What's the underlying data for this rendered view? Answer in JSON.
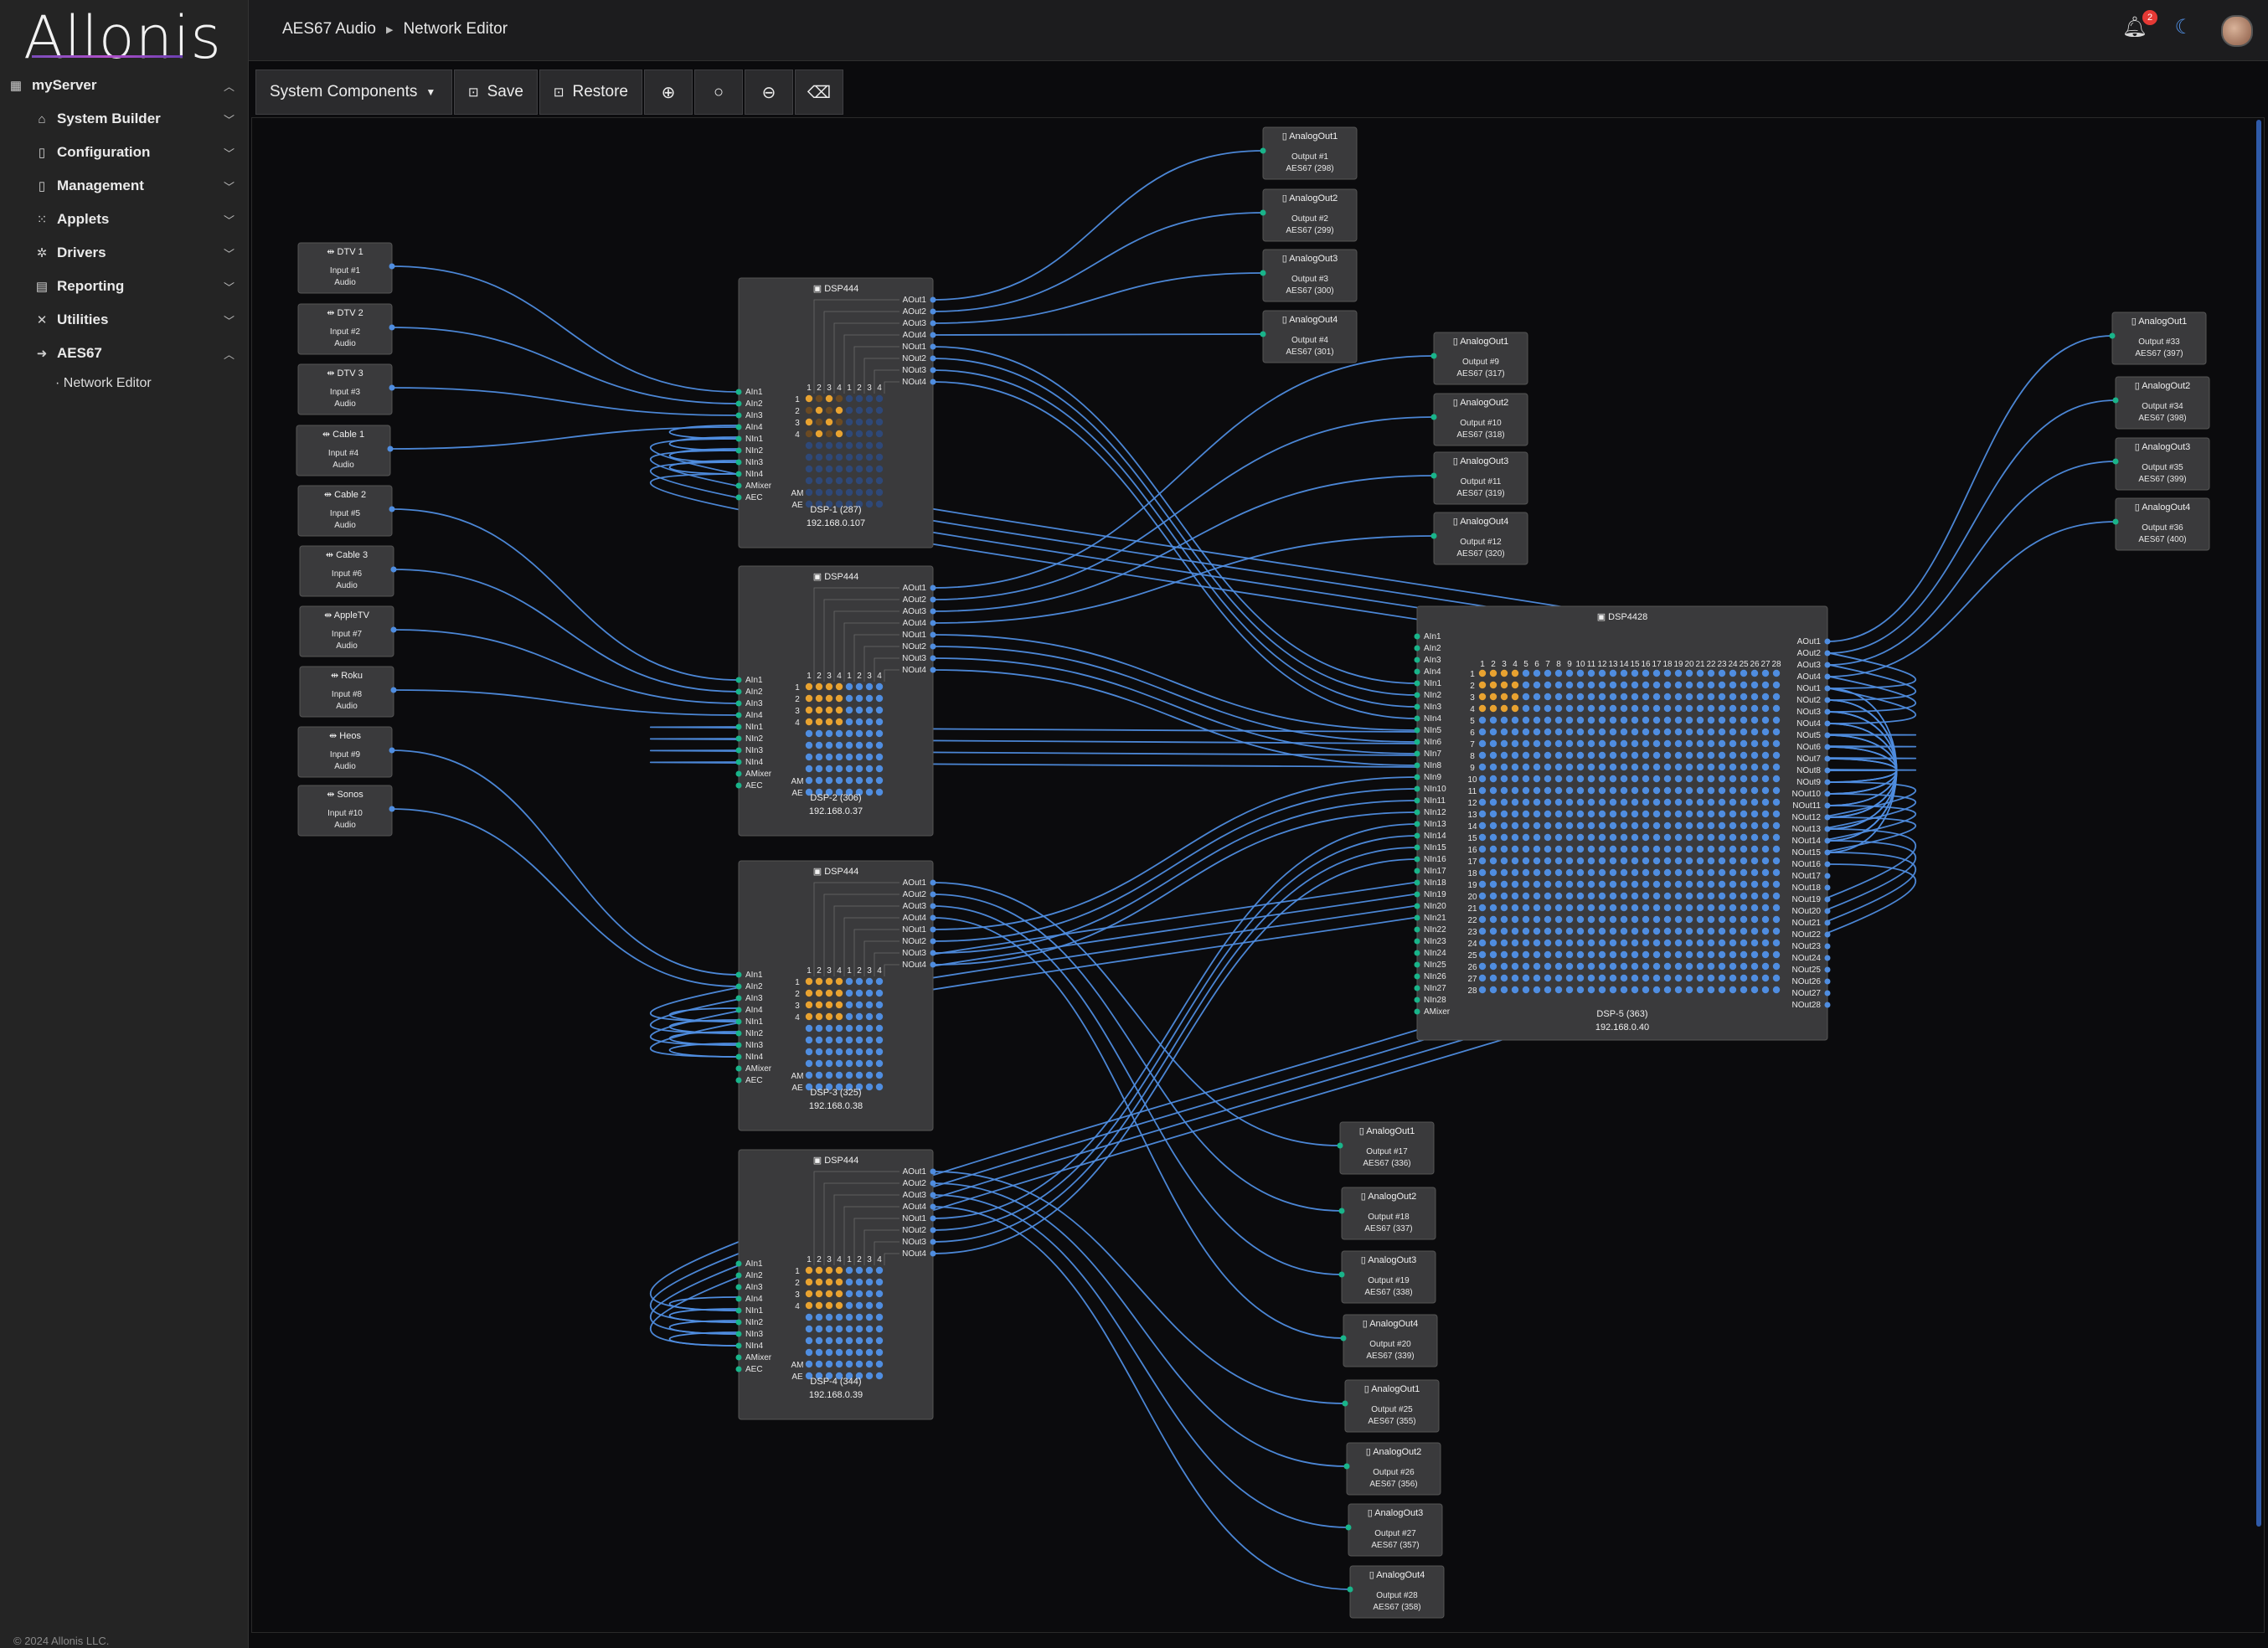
{
  "app": {
    "logo": "Allonis",
    "copyright": "© 2024 Allonis LLC."
  },
  "sidebar": {
    "server": "myServer",
    "items": [
      {
        "label": "System Builder",
        "icon": "home-icon"
      },
      {
        "label": "Configuration",
        "icon": "document-icon"
      },
      {
        "label": "Management",
        "icon": "document-icon"
      },
      {
        "label": "Applets",
        "icon": "grid-icon"
      },
      {
        "label": "Drivers",
        "icon": "drivers-icon"
      },
      {
        "label": "Reporting",
        "icon": "report-icon"
      },
      {
        "label": "Utilities",
        "icon": "tools-icon"
      },
      {
        "label": "AES67",
        "icon": "aes67-icon"
      }
    ],
    "subitem": "· Network Editor"
  },
  "header": {
    "breadcrumb_root": "AES67 Audio",
    "breadcrumb_page": "Network Editor",
    "notifications": "2"
  },
  "toolbar": {
    "components_label": "System Components",
    "save_label": "Save",
    "restore_label": "Restore"
  },
  "colors": {
    "accent": "#4f8de0",
    "routed": "#e8a230",
    "node_bg": "#3a3a3c",
    "link": "#4f8de0"
  },
  "inputs": [
    {
      "name": "DTV 1",
      "line1": "Input #1",
      "line2": "Audio"
    },
    {
      "name": "DTV 2",
      "line1": "Input #2",
      "line2": "Audio"
    },
    {
      "name": "DTV 3",
      "line1": "Input #3",
      "line2": "Audio"
    },
    {
      "name": "Cable 1",
      "line1": "Input #4",
      "line2": "Audio"
    },
    {
      "name": "Cable 2",
      "line1": "Input #5",
      "line2": "Audio"
    },
    {
      "name": "Cable 3",
      "line1": "Input #6",
      "line2": "Audio"
    },
    {
      "name": "AppleTV",
      "line1": "Input #7",
      "line2": "Audio"
    },
    {
      "name": "Roku",
      "line1": "Input #8",
      "line2": "Audio"
    },
    {
      "name": "Heos",
      "line1": "Input #9",
      "line2": "Audio"
    },
    {
      "name": "Sonos",
      "line1": "Input #10",
      "line2": "Audio"
    }
  ],
  "dsps": [
    {
      "type": "DSP444",
      "label": "DSP-1 (287)",
      "ip": "192.168.0.107"
    },
    {
      "type": "DSP444",
      "label": "DSP-2 (306)",
      "ip": "192.168.0.37"
    },
    {
      "type": "DSP444",
      "label": "DSP-3 (325)",
      "ip": "192.168.0.38"
    },
    {
      "type": "DSP444",
      "label": "DSP-4 (344)",
      "ip": "192.168.0.39"
    },
    {
      "type": "DSP4428",
      "label": "DSP-5 (363)",
      "ip": "192.168.0.40"
    }
  ],
  "outputs": [
    {
      "name": "AnalogOut1",
      "line1": "Output #1",
      "line2": "AES67 (298)"
    },
    {
      "name": "AnalogOut2",
      "line1": "Output #2",
      "line2": "AES67 (299)"
    },
    {
      "name": "AnalogOut3",
      "line1": "Output #3",
      "line2": "AES67 (300)"
    },
    {
      "name": "AnalogOut4",
      "line1": "Output #4",
      "line2": "AES67 (301)"
    },
    {
      "name": "AnalogOut1",
      "line1": "Output #9",
      "line2": "AES67 (317)"
    },
    {
      "name": "AnalogOut2",
      "line1": "Output #10",
      "line2": "AES67 (318)"
    },
    {
      "name": "AnalogOut3",
      "line1": "Output #11",
      "line2": "AES67 (319)"
    },
    {
      "name": "AnalogOut4",
      "line1": "Output #12",
      "line2": "AES67 (320)"
    },
    {
      "name": "AnalogOut1",
      "line1": "Output #33",
      "line2": "AES67 (397)"
    },
    {
      "name": "AnalogOut2",
      "line1": "Output #34",
      "line2": "AES67 (398)"
    },
    {
      "name": "AnalogOut3",
      "line1": "Output #35",
      "line2": "AES67 (399)"
    },
    {
      "name": "AnalogOut4",
      "line1": "Output #36",
      "line2": "AES67 (400)"
    },
    {
      "name": "AnalogOut1",
      "line1": "Output #17",
      "line2": "AES67 (336)"
    },
    {
      "name": "AnalogOut2",
      "line1": "Output #18",
      "line2": "AES67 (337)"
    },
    {
      "name": "AnalogOut3",
      "line1": "Output #19",
      "line2": "AES67 (338)"
    },
    {
      "name": "AnalogOut4",
      "line1": "Output #20",
      "line2": "AES67 (339)"
    },
    {
      "name": "AnalogOut1",
      "line1": "Output #25",
      "line2": "AES67 (355)"
    },
    {
      "name": "AnalogOut2",
      "line1": "Output #26",
      "line2": "AES67 (356)"
    },
    {
      "name": "AnalogOut3",
      "line1": "Output #27",
      "line2": "AES67 (357)"
    },
    {
      "name": "AnalogOut4",
      "line1": "Output #28",
      "line2": "AES67 (358)"
    }
  ],
  "dsp444_in_ports": [
    "AIn1",
    "AIn2",
    "AIn3",
    "AIn4",
    "NIn1",
    "NIn2",
    "NIn3",
    "NIn4",
    "AMixer",
    "AEC"
  ],
  "dsp444_out_ports": [
    "AOut1",
    "AOut2",
    "AOut3",
    "AOut4",
    "NOut1",
    "NOut2",
    "NOut3",
    "NOut4"
  ],
  "dsp4428_in_ports": [
    "AIn1",
    "AIn2",
    "AIn3",
    "AIn4",
    "NIn1",
    "NIn2",
    "NIn3",
    "NIn4",
    "NIn5",
    "NIn6",
    "NIn7",
    "NIn8",
    "NIn9",
    "NIn10",
    "NIn11",
    "NIn12",
    "NIn13",
    "NIn14",
    "NIn15",
    "NIn16",
    "NIn17",
    "NIn18",
    "NIn19",
    "NIn20",
    "NIn21",
    "NIn22",
    "NIn23",
    "NIn24",
    "NIn25",
    "NIn26",
    "NIn27",
    "NIn28",
    "AMixer"
  ],
  "dsp4428_out_ports": [
    "AOut1",
    "AOut2",
    "AOut3",
    "AOut4",
    "NOut1",
    "NOut2",
    "NOut3",
    "NOut4",
    "NOut5",
    "NOut6",
    "NOut7",
    "NOut8",
    "NOut9",
    "NOut10",
    "NOut11",
    "NOut12",
    "NOut13",
    "NOut14",
    "NOut15",
    "NOut16",
    "NOut17",
    "NOut18",
    "NOut19",
    "NOut20",
    "NOut21",
    "NOut22",
    "NOut23",
    "NOut24",
    "NOut25",
    "NOut26",
    "NOut27",
    "NOut28"
  ],
  "matrix_row_labels_444": [
    "1",
    "2",
    "3",
    "4",
    "",
    "",
    "",
    "",
    "AM",
    "AE"
  ],
  "matrix_col_labels_444": [
    "1",
    "2",
    "3",
    "4",
    "1",
    "2",
    "3",
    "4"
  ]
}
